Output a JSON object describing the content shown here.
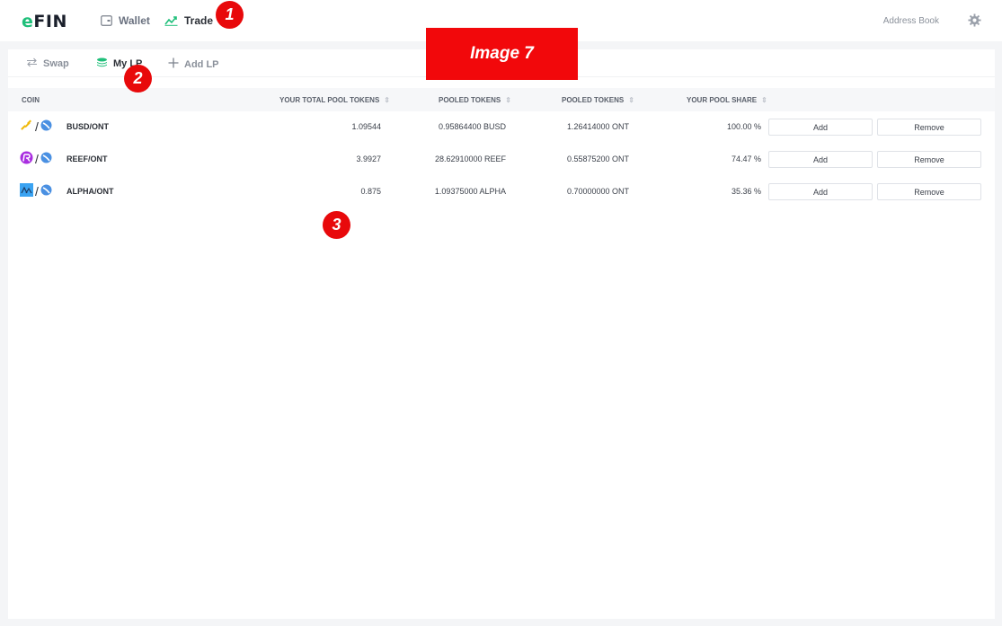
{
  "topbar": {
    "logo_e": "e",
    "logo_rest": "FIN",
    "nav": [
      {
        "label": "Wallet",
        "icon": "wallet-icon"
      },
      {
        "label": "Trade",
        "icon": "trending-up-icon"
      }
    ],
    "address_book": "Address Book",
    "settings_icon": "gear-icon"
  },
  "subnav": {
    "items": [
      {
        "label": "Swap",
        "icon": "swap-icon"
      },
      {
        "label": "My LP",
        "icon": "coins-stack-icon"
      },
      {
        "label": "Add LP",
        "icon": "plus-icon"
      }
    ]
  },
  "table": {
    "headers": [
      "COIN",
      "YOUR TOTAL POOL TOKENS",
      "POOLED TOKENS",
      "POOLED TOKENS",
      "YOUR POOL SHARE"
    ],
    "rows": [
      {
        "pair": "BUSD/ONT",
        "total": "1.09544",
        "pooled_a": "0.95864400 BUSD",
        "pooled_b": "1.26414000 ONT",
        "share": "100.00 %",
        "add": "Add",
        "remove": "Remove"
      },
      {
        "pair": "REEF/ONT",
        "total": "3.9927",
        "pooled_a": "28.62910000 REEF",
        "pooled_b": "0.55875200 ONT",
        "share": "74.47 %",
        "add": "Add",
        "remove": "Remove"
      },
      {
        "pair": "ALPHA/ONT",
        "total": "0.875",
        "pooled_a": "1.09375000 ALPHA",
        "pooled_b": "0.70000000 ONT",
        "share": "35.36 %",
        "add": "Add",
        "remove": "Remove"
      }
    ]
  },
  "annotations": {
    "image_label": "Image 7",
    "markers": [
      "1",
      "2",
      "3"
    ]
  },
  "colors": {
    "accent_green": "#1fbf7a",
    "annotation_red": "#e8090b"
  }
}
